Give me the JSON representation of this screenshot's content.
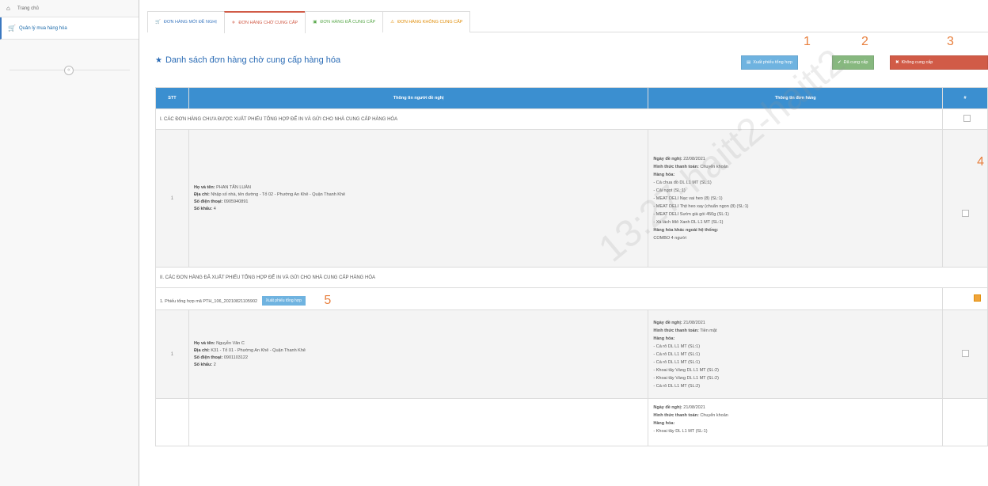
{
  "sidebar": {
    "items": [
      {
        "label": "Trang chủ",
        "icon": "home-icon"
      },
      {
        "label": "Quản lý mua hàng hóa",
        "icon": "cart-icon"
      }
    ],
    "collapse_glyph": "«"
  },
  "tabs": [
    {
      "label": "Đơn hàng mới đề nghị",
      "icon": "cart-icon",
      "color": "#3b78c0"
    },
    {
      "label": "Đơn hàng chờ cung cấp",
      "icon": "plane-icon",
      "color": "#d15b47"
    },
    {
      "label": "Đơn hàng đã cung cấp",
      "icon": "cubes-icon",
      "color": "#59a84b"
    },
    {
      "label": "Đơn hàng không cung cấp",
      "icon": "warning-icon",
      "color": "#e08e0b"
    }
  ],
  "section_title": "Danh sách đơn hàng chờ cung cấp hàng hóa",
  "actions": {
    "export": "Xuất phiếu tổng hợp",
    "provide": "Đã cung cấp",
    "not_provide": "Không cung cấp"
  },
  "annotations": [
    "1",
    "2",
    "3",
    "4",
    "5"
  ],
  "table": {
    "headers": [
      "STT",
      "Thông tin người đề nghị",
      "Thông tin đơn hàng",
      "#"
    ],
    "group1": "I. Các đơn hàng chưa được xuất phiếu tổng hợp để in và gửi cho nhà cung cấp hàng hóa",
    "group2": "II. Các đơn hàng đã xuất phiếu tổng hợp để in và gửi cho nhà cung cấp hàng hóa",
    "row1": {
      "stt": "1",
      "name_label": "Họ và tên:",
      "name": "PHAN TẤN LUÂN",
      "addr_label": "Địa chỉ:",
      "addr": "Nhập số nhà, tên đường - Tổ 02 - Phường An Khê - Quận Thanh Khê",
      "phone_label": "Số điện thoại:",
      "phone": "0905940891",
      "count_label": "Số khẩu:",
      "count": "4",
      "date_label": "Ngày đề nghị:",
      "date": "22/08/2021",
      "pay_label": "Hình thức thanh toán:",
      "pay": "Chuyển khoản",
      "goods_label": "Hàng hóa:",
      "goods": [
        "- Cá chua đồ DL L1 MT (SL:1)",
        "- Cải ngọt (SL:1)",
        "- MEAT DELI Nạc vai heo (8) (SL:1)",
        "- MEAT DELI Thịt heo xay (chuẩn ngon (8) (SL:1)",
        "- MEAT DELI Sườn già gói 450g (SL:1)",
        "- Xà lách lôlô Xanh DL L1 MT (SL:1)"
      ],
      "other_label": "Hàng hóa khác ngoài hệ thống:",
      "other": "COMBO 4 người"
    },
    "sheet": {
      "label": "1. Phiếu tổng hợp mã PTH_106_20210821105902",
      "button": "Xuất phiếu tổng hợp"
    },
    "row2": {
      "stt": "1",
      "name_label": "Họ và tên:",
      "name": "Nguyễn Văn C",
      "addr_label": "Địa chỉ:",
      "addr": "K31 - Tổ 01 - Phường An Khê - Quận Thanh Khê",
      "phone_label": "Số điện thoại:",
      "phone": "0901103122",
      "count_label": "Số khẩu:",
      "count": "2",
      "date_label": "Ngày đề nghị:",
      "date": "21/08/2021",
      "pay_label": "Hình thức thanh toán:",
      "pay": "Tiền mặt",
      "goods_label": "Hàng hóa:",
      "goods": [
        "- Cá rô DL L1 MT (SL:1)",
        "- Cá rô DL L1 MT (SL:1)",
        "- Cá rô DL L1 MT (SL:1)",
        "- Khoai tây Vàng DL L1 MT (SL:2)",
        "- Khoai tây Vàng DL L1 MT (SL:2)",
        "- Cá rô DL L1 MT (SL:2)"
      ]
    },
    "row3": {
      "date_label": "Ngày đề nghị:",
      "date": "21/08/2021",
      "pay_label": "Hình thức thanh toán:",
      "pay": "Chuyển khoản",
      "goods_label": "Hàng hóa:",
      "goods": [
        "- Khoai tây DL L1 MT (SL:1)"
      ]
    }
  },
  "watermark": "13:27-haitt2-haitt2"
}
